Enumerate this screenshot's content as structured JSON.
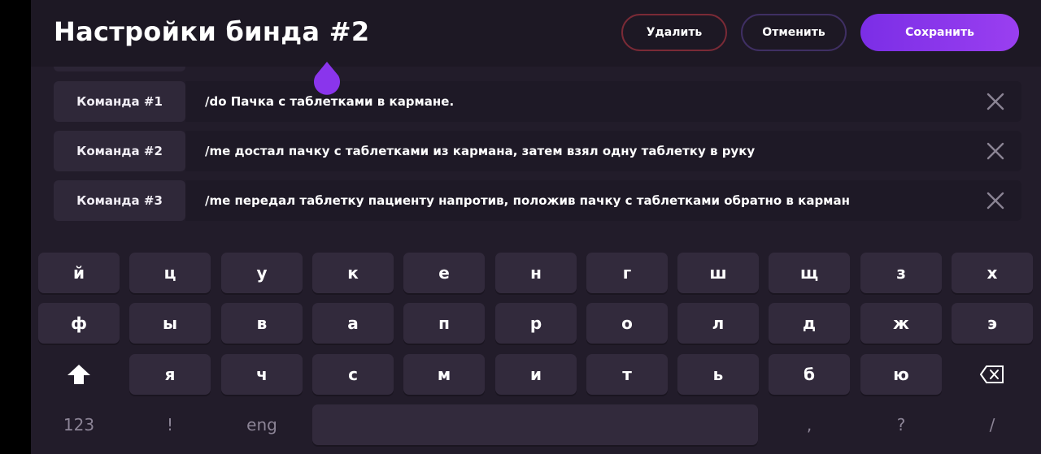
{
  "header": {
    "title": "Настройки бинда #2",
    "delete_label": "Удалить",
    "cancel_label": "Отменить",
    "save_label": "Сохранить"
  },
  "commands": [
    {
      "label": "Команда #1",
      "text": "/do Пачка с таблетками в кармане."
    },
    {
      "label": "Команда #2",
      "text": "/me достал пачку с таблетками из кармана, затем взял одну таблетку в руку"
    },
    {
      "label": "Команда #3",
      "text": "/me передал таблетку пациенту напротив, положив пачку с таблетками обратно в карман"
    }
  ],
  "keyboard": {
    "row1": [
      "й",
      "ц",
      "у",
      "к",
      "е",
      "н",
      "г",
      "ш",
      "щ",
      "з",
      "х"
    ],
    "row2": [
      "ф",
      "ы",
      "в",
      "а",
      "п",
      "р",
      "о",
      "л",
      "д",
      "ж",
      "э"
    ],
    "row3": [
      "shift-icon",
      "я",
      "ч",
      "с",
      "м",
      "и",
      "т",
      "ь",
      "б",
      "ю",
      "backspace-icon"
    ],
    "row4": {
      "num": "123",
      "excl": "!",
      "lang": "eng",
      "space": "",
      "comma": ",",
      "question": "?",
      "slash": "/"
    }
  },
  "colors": {
    "background": "#221c2a",
    "accent": "#8a35ec",
    "delete_border": "#7a2a36",
    "cancel_border": "#3f2f63"
  }
}
